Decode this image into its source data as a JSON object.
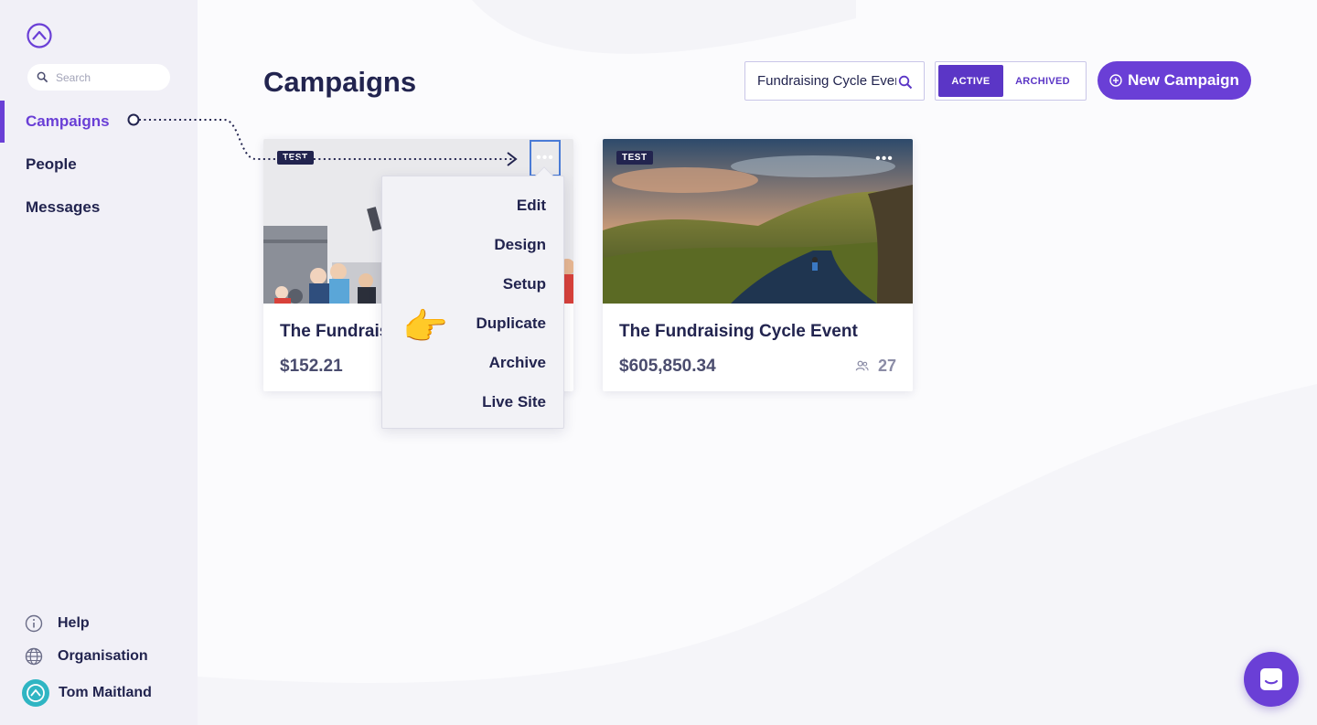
{
  "sidebar": {
    "search_placeholder": "Search",
    "nav": [
      {
        "label": "Campaigns",
        "active": true
      },
      {
        "label": "People",
        "active": false
      },
      {
        "label": "Messages",
        "active": false
      }
    ],
    "bottom": {
      "help": "Help",
      "organisation": "Organisation",
      "user": "Tom Maitland"
    }
  },
  "header": {
    "title": "Campaigns",
    "filter_value": "Fundraising Cycle Event",
    "toggle": {
      "active": "ACTIVE",
      "archived": "ARCHIVED"
    },
    "new_button": "New Campaign"
  },
  "cards": [
    {
      "tag": "TEST",
      "title": "The Fundraising Cycle Event",
      "amount": "$152.21",
      "menu_icon": "more-dots-icon"
    },
    {
      "tag": "TEST",
      "title": "The Fundraising Cycle Event",
      "amount": "$605,850.34",
      "participants": "27",
      "menu_icon": "more-dots-icon"
    }
  ],
  "menu": {
    "items": [
      "Edit",
      "Design",
      "Setup",
      "Duplicate",
      "Archive",
      "Live Site"
    ]
  },
  "colors": {
    "accent": "#6a3fd6",
    "navy": "#22244f",
    "sidebar_bg": "#f1f0f7",
    "avatar": "#2fb5c3"
  }
}
